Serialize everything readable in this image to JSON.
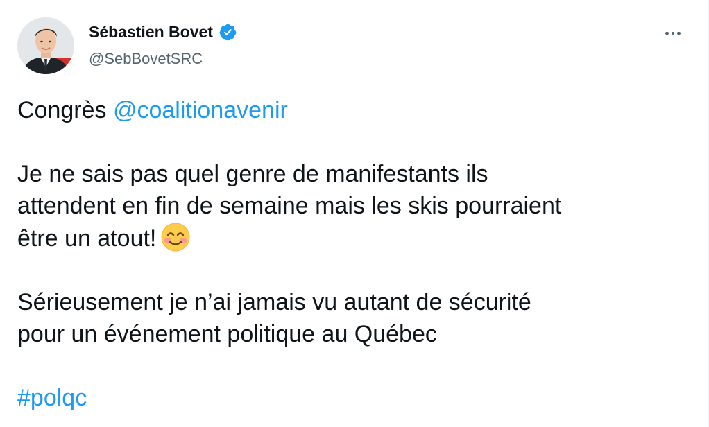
{
  "tweet": {
    "author": {
      "display_name": "Sébastien Bovet",
      "handle": "@SebBovetSRC",
      "verified": true
    },
    "more_icon": "more-horizontal-icon",
    "body": {
      "line1_prefix": "Congrès ",
      "line1_mention": "@coalitionavenir",
      "para2_line1": "Je ne sais pas quel genre de manifestants ils",
      "para2_line2": "attendent en fin de semaine mais les skis pourraient",
      "para2_line3": "être un atout!",
      "emoji": "smiling-face-with-blushing-cheeks",
      "para3_line1": "Sérieusement je n’ai jamais vu autant de sécurité",
      "para3_line2": "pour un événement politique au Québec",
      "hashtag": "#polqc"
    }
  },
  "colors": {
    "text": "#0f1419",
    "secondary": "#536471",
    "link": "#1d9bf0",
    "verified": "#1d9bf0"
  }
}
